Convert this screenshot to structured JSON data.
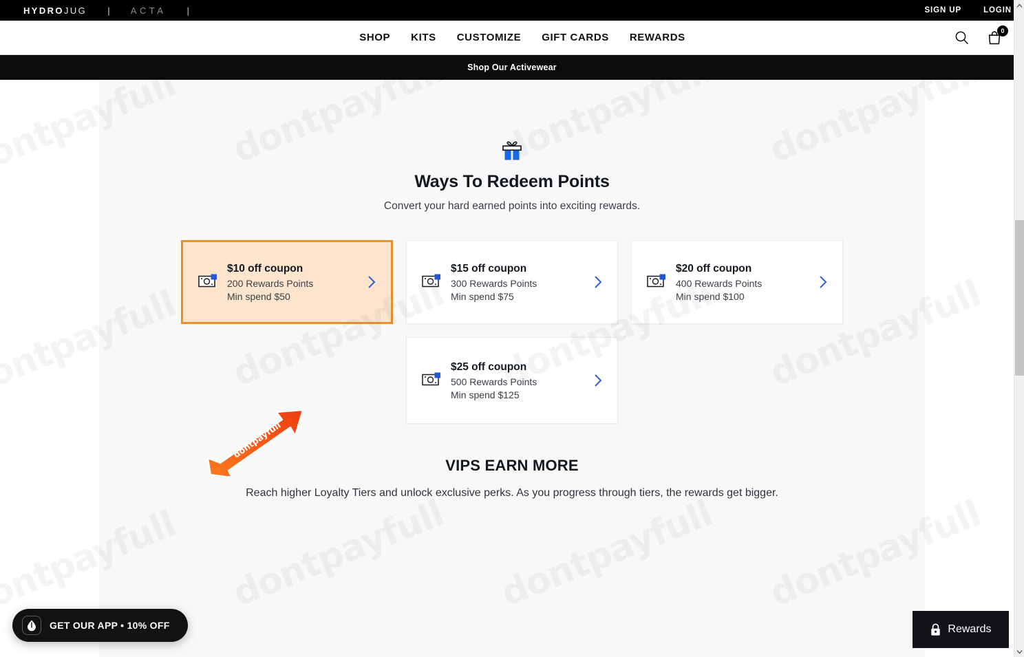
{
  "topbar": {
    "brand_primary": "HYDRO",
    "brand_secondary": "JUG",
    "divider": "|",
    "brand_partner": "ACTA",
    "sign_up": "SIGN UP",
    "login": "LOGIN"
  },
  "nav": {
    "items": [
      {
        "label": "SHOP"
      },
      {
        "label": "KITS"
      },
      {
        "label": "CUSTOMIZE"
      },
      {
        "label": "GIFT CARDS"
      },
      {
        "label": "REWARDS"
      }
    ],
    "search_icon": "search-icon",
    "cart_icon": "shopping-bag-icon",
    "cart_count": "0"
  },
  "announcement": {
    "text": "Shop Our Activewear"
  },
  "redeem": {
    "icon": "gift-icon",
    "title": "Ways To Redeem Points",
    "subtitle": "Convert your hard earned points into exciting rewards.",
    "cards": [
      {
        "title": "$10 off coupon",
        "points": "200 Rewards Points",
        "min_spend": "Min spend $50",
        "icon": "banknote-icon",
        "chevron": "chevron-right-icon",
        "selected": true
      },
      {
        "title": "$15 off coupon",
        "points": "300 Rewards Points",
        "min_spend": "Min spend $75",
        "icon": "banknote-icon",
        "chevron": "chevron-right-icon",
        "selected": false
      },
      {
        "title": "$20 off coupon",
        "points": "400 Rewards Points",
        "min_spend": "Min spend $100",
        "icon": "banknote-icon",
        "chevron": "chevron-right-icon",
        "selected": false
      },
      {
        "title": "$25 off coupon",
        "points": "500 Rewards Points",
        "min_spend": "Min spend $125",
        "icon": "banknote-icon",
        "chevron": "chevron-right-icon",
        "selected": false
      }
    ]
  },
  "vip": {
    "title": "VIPS EARN MORE",
    "subtitle": "Reach higher Loyalty Tiers and unlock exclusive perks. As you progress through tiers, the rewards get bigger."
  },
  "app_pill": {
    "icon": "water-drop-icon",
    "label": "GET OUR APP • 10% OFF"
  },
  "rewards_launcher": {
    "icon": "lock-icon",
    "label": "Rewards"
  },
  "annotation": {
    "arrow_label": "dontpayfull"
  },
  "watermark": {
    "text": "dontpayfull"
  },
  "colors": {
    "selected_card_border": "#E8902A",
    "selected_card_fill": "#FCE4CD",
    "chevron_blue": "#2F62CF",
    "gift_blue": "#1167E8",
    "arrow_orange": "#F4530E",
    "dark": "#000000"
  }
}
